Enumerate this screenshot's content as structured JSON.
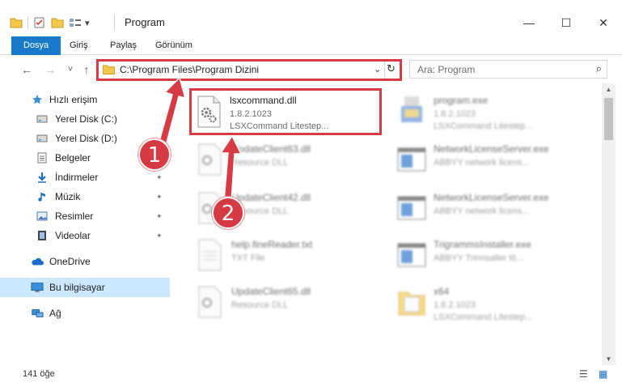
{
  "window": {
    "title": "Program",
    "minimize_glyph": "—",
    "maximize_glyph": "☐",
    "close_glyph": "✕"
  },
  "quick_access": {
    "dropdown_glyph": "▾"
  },
  "ribbon": {
    "tabs": [
      {
        "label": "Dosya",
        "active": true
      },
      {
        "label": "Giriş",
        "active": false
      },
      {
        "label": "Paylaş",
        "active": false
      },
      {
        "label": "Görünüm",
        "active": false
      }
    ]
  },
  "nav": {
    "back_glyph": "←",
    "forward_glyph": "→",
    "recent_glyph": "˅",
    "up_glyph": "↑",
    "address_path": "C:\\Program Files\\Program Dizini",
    "dropdown_glyph": "⌄",
    "refresh_glyph": "↻",
    "search_placeholder": "Ara: Program",
    "search_glyph": "⌕"
  },
  "sidebar": {
    "pin_glyph": "📌",
    "items": [
      {
        "label": "Hızlı erişim",
        "icon": "star-icon"
      },
      {
        "label": "Yerel Disk (C:)",
        "icon": "drive-icon"
      },
      {
        "label": "Yerel Disk (D:)",
        "icon": "drive-icon"
      },
      {
        "label": "Belgeler",
        "icon": "documents-icon"
      },
      {
        "label": "İndirmeler",
        "icon": "download-icon"
      },
      {
        "label": "Müzik",
        "icon": "music-icon"
      },
      {
        "label": "Resimler",
        "icon": "pictures-icon"
      },
      {
        "label": "Videolar",
        "icon": "video-icon"
      },
      {
        "label": "OneDrive",
        "icon": "cloud-icon"
      },
      {
        "label": "Bu bilgisayar",
        "icon": "computer-icon"
      },
      {
        "label": "Ağ",
        "icon": "network-icon"
      }
    ]
  },
  "files": [
    {
      "name": "lsxcommand.dll",
      "line1": "1.8.2.1023",
      "line2": "LSXCommand Litestep...",
      "icon": "dll-gear-icon"
    },
    {
      "name": "program.exe",
      "line1": "1.8.2.1023",
      "line2": "LSXCommand Litestep...",
      "icon": "exe-icon"
    },
    {
      "name": "UpdateClient63.dll",
      "line1": "Resource DLL",
      "line2": "",
      "icon": "dll-gear-icon"
    },
    {
      "name": "NetworkLicenseServer.exe",
      "line1": "ABBYY network licens...",
      "line2": "",
      "icon": "app-window-icon"
    },
    {
      "name": "UpdateClient42.dll",
      "line1": "Resource DLL",
      "line2": "",
      "icon": "dll-gear-icon"
    },
    {
      "name": "NetworkLicenseServer.exe",
      "line1": "ABBYY network licens...",
      "line2": "",
      "icon": "app-window-icon"
    },
    {
      "name": "help.fineReader.txt",
      "line1": "TXT File",
      "line2": "",
      "icon": "text-file-icon"
    },
    {
      "name": "TrigrammsInstaller.exe",
      "line1": "ABBYY Trinnsaller tit...",
      "line2": "",
      "icon": "app-window-icon"
    },
    {
      "name": "UpdateClient65.dll",
      "line1": "Resource DLL",
      "line2": "",
      "icon": "dll-gear-icon"
    },
    {
      "name": "x64",
      "line1": "1.8.2.1023",
      "line2": "LSXCommand Litestep...",
      "icon": "folder-icon"
    }
  ],
  "status": {
    "item_count": "141 öğe",
    "details_view_glyph": "☰",
    "tiles_view_glyph": "▦"
  },
  "annotations": [
    {
      "label": "1"
    },
    {
      "label": "2"
    }
  ],
  "colors": {
    "accent": "#1979ca",
    "highlight_red": "#d63a42",
    "selected_bg": "#cce8ff"
  }
}
